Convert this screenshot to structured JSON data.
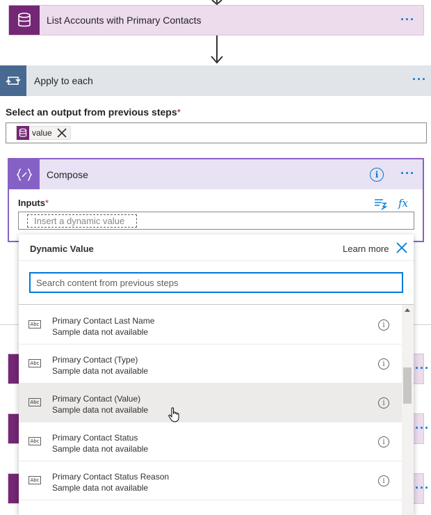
{
  "steps": {
    "list_accounts": {
      "title": "List Accounts with Primary Contacts",
      "icon": "database-icon"
    },
    "apply_to_each": {
      "title": "Apply to each",
      "icon": "loop-icon",
      "select_label": "Select an output from previous steps",
      "required_mark": "*",
      "token": {
        "label": "value",
        "icon": "database-icon"
      }
    },
    "compose": {
      "title": "Compose",
      "icon": "compose-icon",
      "info_glyph": "i",
      "inputs_label": "Inputs",
      "required_mark": "*",
      "fx_label": "fx",
      "placeholder": "Insert a dynamic value"
    }
  },
  "more_glyph": "···",
  "dynamic_panel": {
    "title": "Dynamic Value",
    "learn_more": "Learn more",
    "search_placeholder": "Search content from previous steps",
    "type_glyph": "Abc",
    "info_glyph": "i",
    "items": [
      {
        "name": "Primary Contact Last Name",
        "desc": "Sample data not available"
      },
      {
        "name": "Primary Contact (Type)",
        "desc": "Sample data not available"
      },
      {
        "name": "Primary Contact (Value)",
        "desc": "Sample data not available",
        "hovered": true
      },
      {
        "name": "Primary Contact Status",
        "desc": "Sample data not available"
      },
      {
        "name": "Primary Contact Status Reason",
        "desc": "Sample data not available"
      }
    ]
  },
  "colors": {
    "dataverse_purple": "#742774",
    "compose_purple": "#8661c5",
    "loop_blue": "#486991",
    "accent_blue": "#0078d4"
  }
}
